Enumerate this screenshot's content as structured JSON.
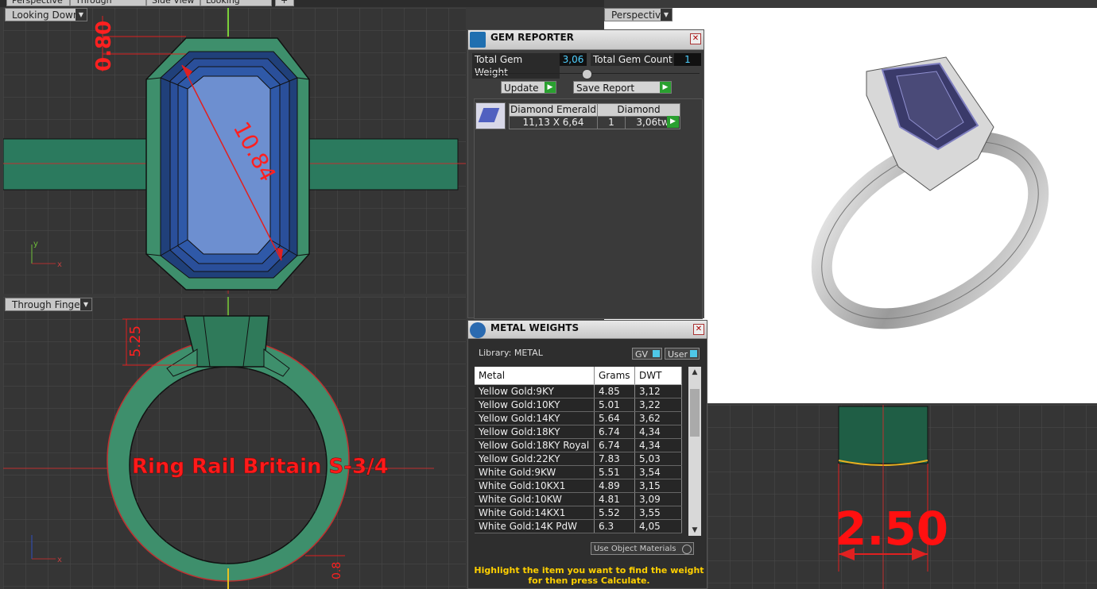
{
  "tabs": [
    "Perspective",
    "Through Finger",
    "Side View",
    "Looking Down",
    "+"
  ],
  "viewports": {
    "looking_down": {
      "label": "Looking Down",
      "dim_top": "0.80",
      "dim_diag": "10.84",
      "axis_y": "y",
      "axis_x": "x"
    },
    "through_finger": {
      "label": "Through Finger",
      "dim_height": "5.25",
      "ring_text": "Ring Rail Britain S-3/4",
      "dim_bottom": "0.8",
      "axis_x": "x"
    },
    "perspective": {
      "label": "Perspective"
    },
    "side_view": {
      "dim": "2.50"
    }
  },
  "gem_reporter": {
    "title": "GEM REPORTER",
    "total_weight_label": "Total Gem Weight",
    "total_weight_value": "3,06",
    "total_count_label": "Total Gem Count",
    "total_count_value": "1",
    "update_label": "Update",
    "save_report_label": "Save Report",
    "row": {
      "name": "Diamond Emerald",
      "type": "Diamond",
      "size": "11,13 X 6,64",
      "qty": "1",
      "weight": "3,06tw"
    }
  },
  "metal_weights": {
    "title": "METAL WEIGHTS",
    "library_label": "Library: METAL",
    "gv_label": "GV",
    "user_label": "User",
    "columns": [
      "Metal",
      "Grams",
      "DWT"
    ],
    "rows": [
      [
        "Yellow Gold:9KY",
        "4.85",
        "3,12"
      ],
      [
        "Yellow Gold:10KY",
        "5.01",
        "3,22"
      ],
      [
        "Yellow Gold:14KY",
        "5.64",
        "3,62"
      ],
      [
        "Yellow Gold:18KY",
        "6.74",
        "4,34"
      ],
      [
        "Yellow Gold:18KY Royal",
        "6.74",
        "4,34"
      ],
      [
        "Yellow Gold:22KY",
        "7.83",
        "5,03"
      ],
      [
        "White Gold:9KW",
        "5.51",
        "3,54"
      ],
      [
        "White Gold:10KX1",
        "4.89",
        "3,15"
      ],
      [
        "White Gold:10KW",
        "4.81",
        "3,09"
      ],
      [
        "White Gold:14KX1",
        "5.52",
        "3,55"
      ],
      [
        "White Gold:14K PdW",
        "6.3",
        "4,05"
      ]
    ],
    "use_object_materials": "Use Object Materials",
    "hint_line1": "Highlight the item you want to find the weight",
    "hint_line2": "for then press Calculate."
  }
}
